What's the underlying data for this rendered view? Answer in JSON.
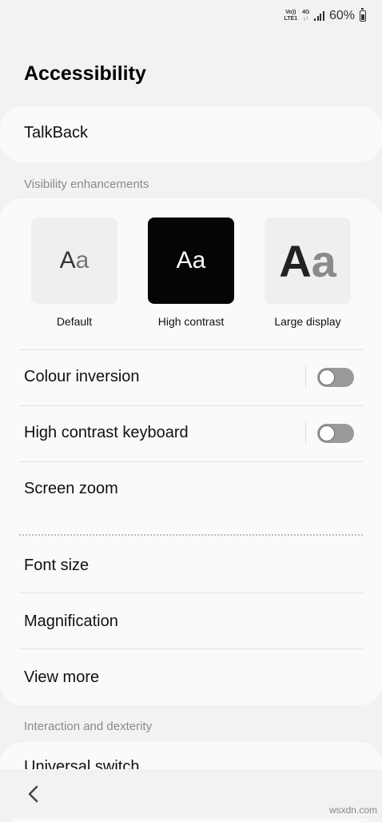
{
  "status_bar": {
    "network_top": "Vo))",
    "network_bottom": "LTE1",
    "network_type": "4G",
    "network_arrows": "↓↑",
    "battery_percent": "60%"
  },
  "page_title": "Accessibility",
  "talkback": {
    "label": "TalkBack"
  },
  "visibility": {
    "section_label": "Visibility enhancements",
    "themes": [
      {
        "name": "Default",
        "glyph_upper": "A",
        "glyph_lower": "a"
      },
      {
        "name": "High contrast",
        "glyph_upper": "A",
        "glyph_lower": "a"
      },
      {
        "name": "Large display",
        "glyph_upper": "A",
        "glyph_lower": "a"
      }
    ],
    "colour_inversion": {
      "label": "Colour inversion",
      "enabled": false
    },
    "high_contrast_keyboard": {
      "label": "High contrast keyboard",
      "enabled": false
    },
    "screen_zoom": {
      "label": "Screen zoom"
    },
    "font_size": {
      "label": "Font size"
    },
    "magnification": {
      "label": "Magnification"
    },
    "view_more": {
      "label": "View more"
    }
  },
  "interaction": {
    "section_label": "Interaction and dexterity",
    "universal_switch": {
      "label": "Universal switch"
    }
  },
  "nav": {
    "back_icon": "chevron-left-icon"
  },
  "watermark": "wsxdn.com"
}
